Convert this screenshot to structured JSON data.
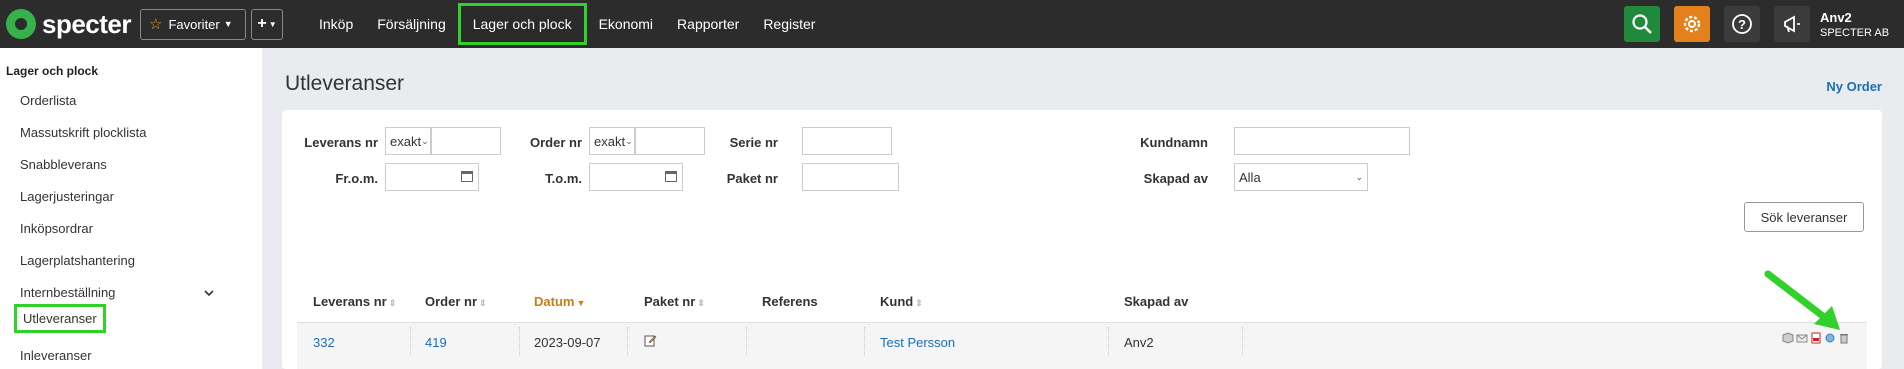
{
  "topbar": {
    "logo": "specter",
    "favorites_label": "Favoriter",
    "add_label": "+",
    "nav": [
      "Inköp",
      "Försäljning",
      "Lager och plock",
      "Ekonomi",
      "Rapporter",
      "Register"
    ],
    "active_nav": "Lager och plock",
    "icons": [
      "search-icon",
      "gear-icon",
      "help-icon",
      "megaphone-icon"
    ],
    "user_name": "Anv2",
    "company": "SPECTER AB"
  },
  "sidebar": {
    "title": "Lager och plock",
    "items": [
      "Orderlista",
      "Massutskrift plocklista",
      "Snabbleverans",
      "Lagerjusteringar",
      "Inköpsordrar",
      "Lagerplatshantering",
      "Internbeställning",
      "Utleveranser",
      "Inleveranser"
    ],
    "active": "Utleveranser"
  },
  "main": {
    "title": "Utleveranser",
    "new_order": "Ny Order"
  },
  "filters": {
    "leverans_nr_label": "Leverans nr",
    "leverans_nr_mode": "exakt",
    "order_nr_label": "Order nr",
    "order_nr_mode": "exakt",
    "serie_nr_label": "Serie nr",
    "kundnamn_label": "Kundnamn",
    "from_label": "Fr.o.m.",
    "tom_label": "T.o.m.",
    "paket_nr_label": "Paket nr",
    "skapad_av_label": "Skapad av",
    "skapad_av_value": "Alla",
    "search_button": "Sök leveranser"
  },
  "table": {
    "columns": [
      "Leverans nr",
      "Order nr",
      "Datum",
      "Paket nr",
      "Referens",
      "Kund",
      "Skapad av"
    ],
    "sorted_column": "Datum",
    "rows": [
      {
        "leverans_nr": "332",
        "order_nr": "419",
        "datum": "2023-09-07",
        "paket_nr": "",
        "referens": "",
        "kund": "Test Persson",
        "skapad_av": "Anv2"
      }
    ]
  },
  "colors": {
    "highlight": "#2fd12a",
    "link": "#1a6fb8",
    "topbar": "#2c2c2c",
    "search_btn": "#1f8a3c",
    "settings_btn": "#e3811c"
  }
}
